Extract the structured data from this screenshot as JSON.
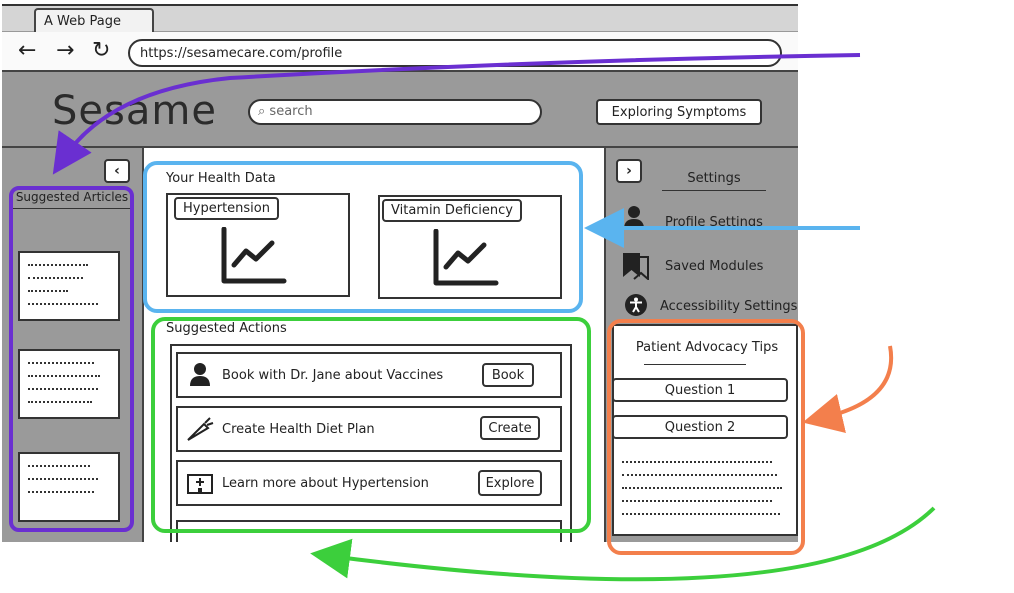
{
  "browser": {
    "tab_title": "A Web Page",
    "url": "https://sesamecare.com/profile"
  },
  "header": {
    "logo": "Sesame",
    "search_placeholder": "search",
    "exploring_button": "Exploring Symptoms"
  },
  "left_sidebar": {
    "title": "Suggested Articles"
  },
  "main": {
    "health_data_title": "Your Health Data",
    "charts": [
      {
        "label": "Hypertension"
      },
      {
        "label": "Vitamin Deficiency"
      }
    ],
    "actions_title": "Suggested Actions",
    "actions": [
      {
        "text": "Book with Dr. Jane about Vaccines",
        "button": "Book",
        "icon": "person-icon"
      },
      {
        "text": "Create Health Diet Plan",
        "button": "Create",
        "icon": "carrot-icon"
      },
      {
        "text": "Learn more about Hypertension",
        "button": "Explore",
        "icon": "hospital-icon"
      }
    ]
  },
  "right_sidebar": {
    "settings_title": "Settings",
    "items": [
      {
        "label": "Profile Settings",
        "icon": "person-icon"
      },
      {
        "label": "Saved Modules",
        "icon": "bookmark-icon"
      },
      {
        "label": "Accessibility Settings",
        "icon": "accessibility-icon"
      }
    ],
    "tips_title": "Patient Advocacy Tips",
    "questions": [
      "Question 1",
      "Question 2"
    ]
  },
  "annotation_colors": {
    "purple": "#6a2fd1",
    "blue": "#5ab4ef",
    "green": "#3ccf3c",
    "orange": "#f37f4c"
  }
}
